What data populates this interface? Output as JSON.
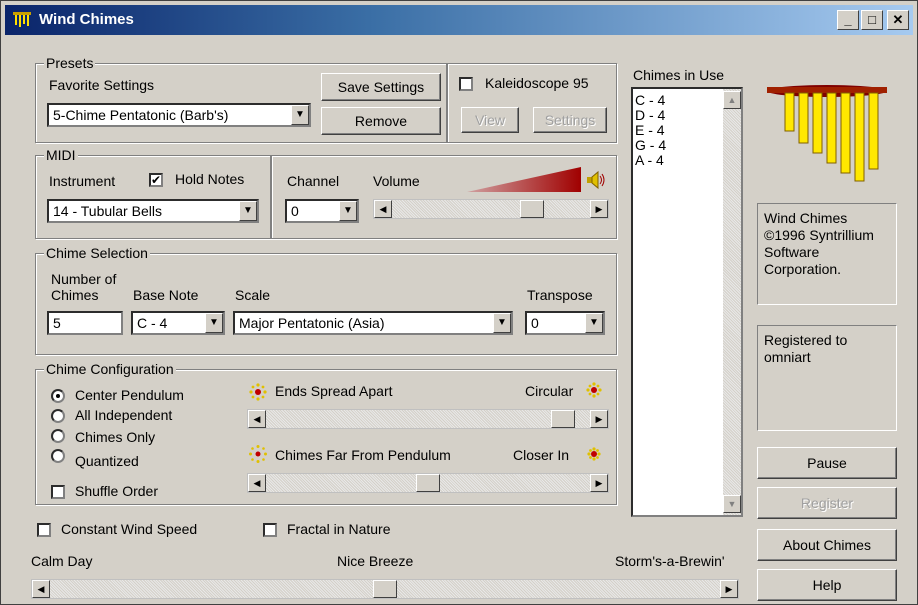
{
  "window": {
    "title": "Wind Chimes",
    "minimize": "_",
    "maximize": "□",
    "close": "✕"
  },
  "presets": {
    "legend": "Presets",
    "favorite_label": "Favorite Settings",
    "favorite_value": "5-Chime Pentatonic (Barb's)",
    "save": "Save Settings",
    "remove": "Remove"
  },
  "kaleidoscope": {
    "label": "Kaleidoscope 95",
    "checked": false,
    "view": "View",
    "settings": "Settings"
  },
  "midi": {
    "legend": "MIDI",
    "instrument_label": "Instrument",
    "hold_notes": "Hold Notes",
    "hold_checked": true,
    "instrument_value": "14 - Tubular Bells",
    "channel_label": "Channel",
    "channel_value": "0",
    "volume_label": "Volume",
    "volume_level": 0.8
  },
  "chime_selection": {
    "legend": "Chime Selection",
    "number_label_1": "Number of",
    "number_label_2": "Chimes",
    "number_value": "5",
    "base_note_label": "Base Note",
    "base_note_value": "C - 4",
    "scale_label": "Scale",
    "scale_value": "Major Pentatonic (Asia)",
    "transpose_label": "Transpose",
    "transpose_value": "0"
  },
  "chime_config": {
    "legend": "Chime Configuration",
    "options": [
      "Center Pendulum",
      "All Independent",
      "Chimes Only",
      "Quantized"
    ],
    "selected": 0,
    "shuffle": "Shuffle Order",
    "spread_left": "Ends Spread Apart",
    "spread_right": "Circular",
    "spread_value": 0.95,
    "distance_left": "Chimes Far From Pendulum",
    "distance_right": "Closer In",
    "distance_value": 0.5
  },
  "chimes_in_use": {
    "label": "Chimes in Use",
    "items": [
      "C - 4",
      "D - 4",
      "E - 4",
      "G - 4",
      "A - 4"
    ]
  },
  "info": {
    "copyright": "Wind Chimes ©1996 Syntrillium Software Corporation.",
    "registered": "Registered to omniart"
  },
  "buttons": {
    "pause": "Pause",
    "register": "Register",
    "about": "About Chimes",
    "help": "Help"
  },
  "wind": {
    "constant": "Constant Wind Speed",
    "fractal": "Fractal in Nature",
    "calm": "Calm Day",
    "breeze": "Nice Breeze",
    "storm": "Storm's-a-Brewin'",
    "value": 0.5
  }
}
